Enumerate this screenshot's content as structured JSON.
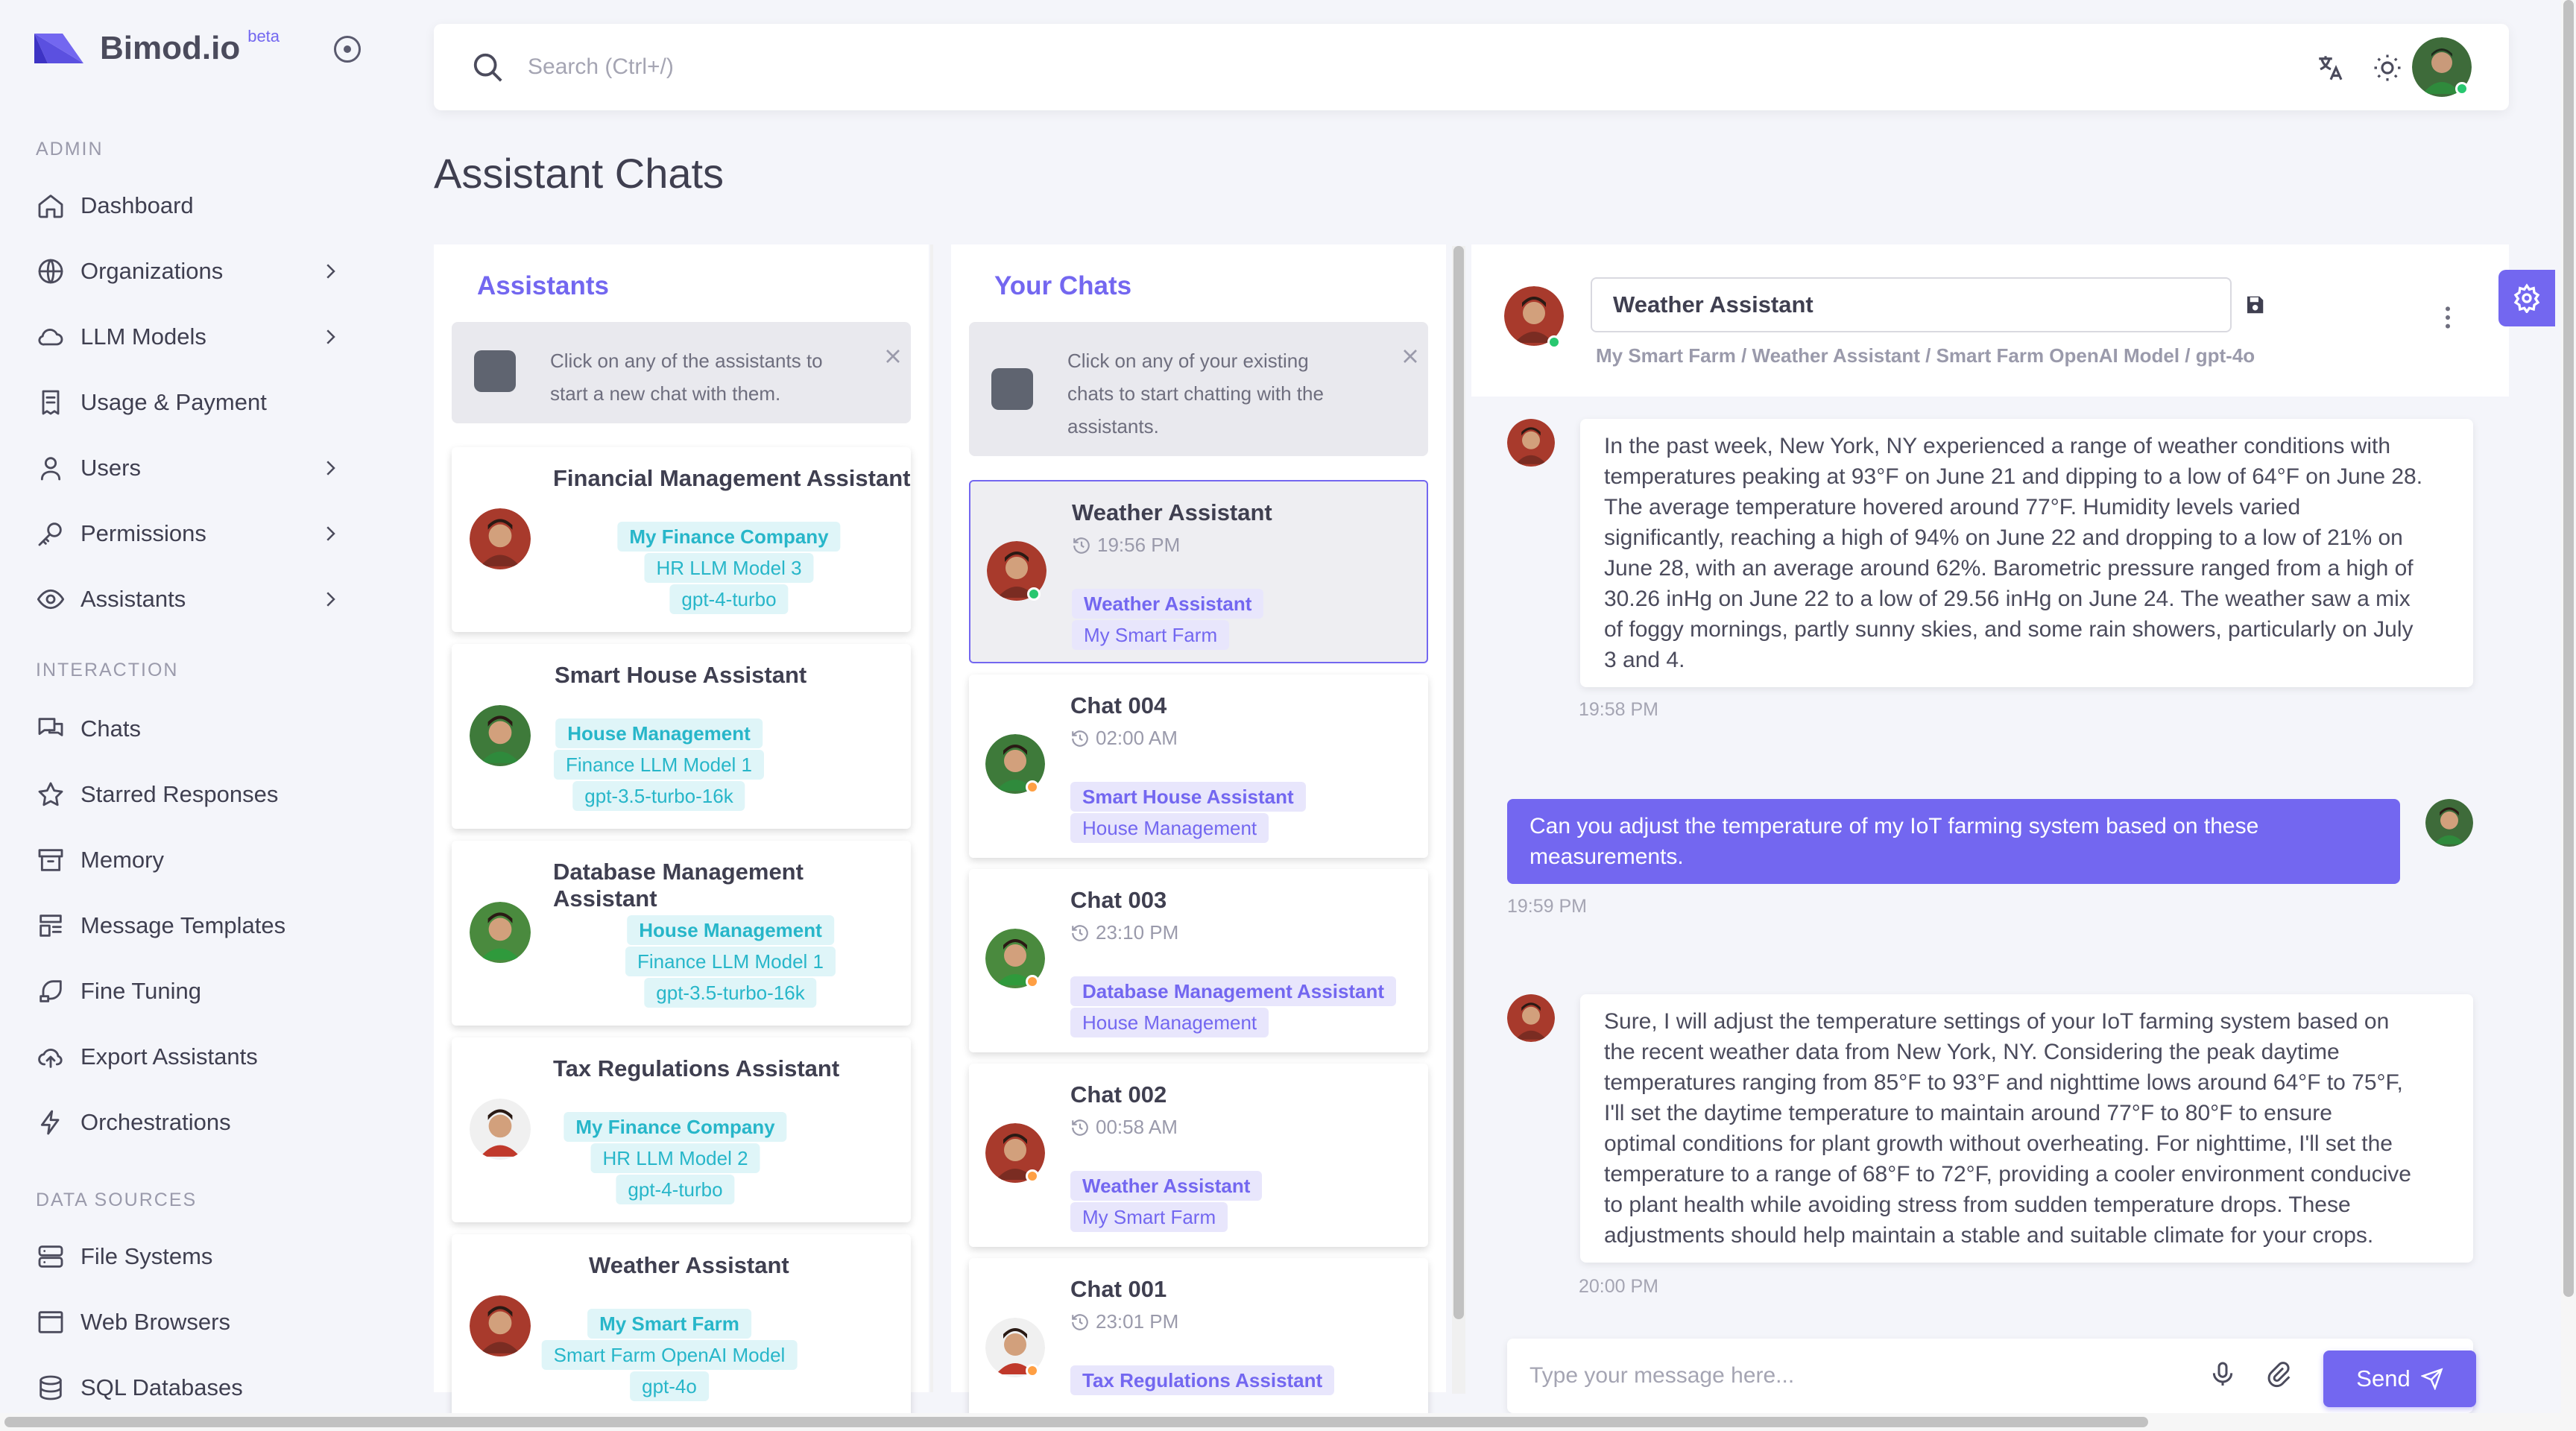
{
  "app": {
    "name": "Bimod.io",
    "beta": "beta"
  },
  "topbar": {
    "search_placeholder": "Search (Ctrl+/)"
  },
  "page_title": "Assistant Chats",
  "sidebar": {
    "sections": [
      {
        "title": "ADMIN",
        "items": [
          {
            "label": "Dashboard",
            "icon": "home-icon",
            "chevron": false
          },
          {
            "label": "Organizations",
            "icon": "globe-icon",
            "chevron": true
          },
          {
            "label": "LLM Models",
            "icon": "cloud-icon",
            "chevron": true
          },
          {
            "label": "Usage & Payment",
            "icon": "receipt-icon",
            "chevron": false
          },
          {
            "label": "Users",
            "icon": "user-icon",
            "chevron": true
          },
          {
            "label": "Permissions",
            "icon": "key-icon",
            "chevron": true
          },
          {
            "label": "Assistants",
            "icon": "eye-icon",
            "chevron": true
          }
        ]
      },
      {
        "title": "INTERACTION",
        "items": [
          {
            "label": "Chats",
            "icon": "messages-icon"
          },
          {
            "label": "Starred Responses",
            "icon": "star-icon"
          },
          {
            "label": "Memory",
            "icon": "archive-icon"
          },
          {
            "label": "Message Templates",
            "icon": "template-icon"
          },
          {
            "label": "Fine Tuning",
            "icon": "brush-icon"
          },
          {
            "label": "Export Assistants",
            "icon": "cloud-upload-icon"
          },
          {
            "label": "Orchestrations",
            "icon": "bolt-icon"
          }
        ]
      },
      {
        "title": "DATA SOURCES",
        "items": [
          {
            "label": "File Systems",
            "icon": "server-icon"
          },
          {
            "label": "Web Browsers",
            "icon": "browser-icon"
          },
          {
            "label": "SQL Databases",
            "icon": "database-icon"
          }
        ]
      }
    ]
  },
  "assistants_panel": {
    "title": "Assistants",
    "info": [
      "Click on any of the assistants to",
      "start a new chat with them."
    ],
    "cards": [
      {
        "name": "Financial Management Assistant",
        "tags": [
          "My Finance Company",
          "HR LLM Model 3",
          "gpt-4-turbo"
        ]
      },
      {
        "name": "Smart House Assistant",
        "tags": [
          "House Management",
          "Finance LLM Model 1",
          "gpt-3.5-turbo-16k"
        ]
      },
      {
        "name": "Database Management Assistant",
        "tags": [
          "House Management",
          "Finance LLM Model 1",
          "gpt-3.5-turbo-16k"
        ]
      },
      {
        "name": "Tax Regulations Assistant",
        "tags": [
          "My Finance Company",
          "HR LLM Model 2",
          "gpt-4-turbo"
        ]
      },
      {
        "name": "Weather Assistant",
        "tags": [
          "My Smart Farm",
          "Smart Farm OpenAI Model",
          "gpt-4o"
        ]
      }
    ]
  },
  "chats_panel": {
    "title": "Your Chats",
    "info": [
      "Click on any of your existing",
      "chats to start chatting with the",
      "assistants."
    ],
    "chats": [
      {
        "name": "Weather Assistant",
        "time": "19:56 PM",
        "assistant": "Weather Assistant",
        "org": "My Smart Farm",
        "active": true,
        "status": "#28c76f"
      },
      {
        "name": "Chat 004",
        "time": "02:00 AM",
        "assistant": "Smart House Assistant",
        "org": "House Management",
        "active": false,
        "status": "#ff9f43"
      },
      {
        "name": "Chat 003",
        "time": "23:10 PM",
        "assistant": "Database Management Assistant",
        "org": "House Management",
        "active": false,
        "status": "#ff9f43"
      },
      {
        "name": "Chat 002",
        "time": "00:58 AM",
        "assistant": "Weather Assistant",
        "org": "My Smart Farm",
        "active": false,
        "status": "#ff9f43"
      },
      {
        "name": "Chat 001",
        "time": "23:01 PM",
        "assistant": "Tax Regulations Assistant",
        "org": "",
        "active": false,
        "status": "#ff9f43"
      }
    ]
  },
  "chat_view": {
    "chat_name": "Weather Assistant",
    "breadcrumb": "My Smart Farm / Weather Assistant / Smart Farm OpenAI Model / gpt-4o",
    "messages": [
      {
        "role": "assistant",
        "time": "19:58 PM",
        "lines": [
          "In the past week, New York, NY experienced a range of weather conditions with",
          "temperatures peaking at 93°F on June 21 and dipping to a low of 64°F on June 28.",
          "The average temperature hovered around 77°F. Humidity levels varied",
          "significantly, reaching a high of 94% on June 22 and dropping to a low of 21% on",
          "June 28, with an average around 62%. Barometric pressure ranged from a high of",
          "30.26 inHg on June 22 to a low of 29.56 inHg on June 24. The weather saw a mix",
          "of foggy mornings, partly sunny skies, and some rain showers, particularly on July",
          "3 and 4."
        ]
      },
      {
        "role": "user",
        "time": "19:59 PM",
        "lines": [
          "Can you adjust the temperature of my IoT farming system based on these",
          "measurements."
        ]
      },
      {
        "role": "assistant",
        "time": "20:00 PM",
        "lines": [
          "Sure, I will adjust the temperature settings of your IoT farming system based on",
          "the recent weather data from New York, NY. Considering the peak daytime",
          "temperatures ranging from 85°F to 93°F and nighttime lows around 64°F to 75°F,",
          "I'll set the daytime temperature to maintain around 77°F to 80°F to ensure",
          "optimal conditions for plant growth without overheating. For nighttime, I'll set the",
          "temperature to a range of 68°F to 72°F, providing a cooler environment conducive",
          "to plant health while avoiding stress from sudden temperature drops. These",
          "adjustments should help maintain a stable and suitable climate for your crops."
        ]
      }
    ],
    "composer": {
      "placeholder": "Type your message here...",
      "send_label": "Send"
    }
  },
  "colors": {
    "accent": "#7367f0",
    "tag_cyan": "#27b6c9",
    "online": "#28c76f",
    "away": "#ff9f43"
  }
}
